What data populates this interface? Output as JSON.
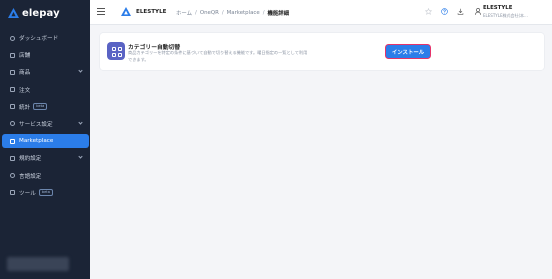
{
  "brand": {
    "name": "elepay",
    "accent": "#2b7de9",
    "sidebar_bg": "#1b2436",
    "highlight": "#e5336a"
  },
  "sidebar": {
    "items": [
      {
        "label": "ダッシュボード",
        "icon": "dashboard-icon",
        "chevron": false,
        "badge": "",
        "active": false
      },
      {
        "label": "店舗",
        "icon": "store-icon",
        "chevron": false,
        "badge": "",
        "active": false
      },
      {
        "label": "商品",
        "icon": "tag-icon",
        "chevron": true,
        "badge": "",
        "active": false
      },
      {
        "label": "注文",
        "icon": "cart-icon",
        "chevron": false,
        "badge": "",
        "active": false
      },
      {
        "label": "統計",
        "icon": "chart-icon",
        "chevron": false,
        "badge": "beta",
        "active": false
      },
      {
        "label": "サービス設定",
        "icon": "gear-icon",
        "chevron": true,
        "badge": "",
        "active": false
      },
      {
        "label": "Marketplace",
        "icon": "grid-icon",
        "chevron": false,
        "badge": "",
        "active": true
      },
      {
        "label": "規約設定",
        "icon": "document-icon",
        "chevron": true,
        "badge": "",
        "active": false
      },
      {
        "label": "言語設定",
        "icon": "globe-icon",
        "chevron": false,
        "badge": "",
        "active": false
      },
      {
        "label": "ツール",
        "icon": "wrench-icon",
        "chevron": false,
        "badge": "beta",
        "active": false
      }
    ]
  },
  "header": {
    "tenant_name": "ELESTYLE",
    "breadcrumb": [
      "ホーム",
      "OneQR",
      "Marketplace",
      "機能詳細"
    ],
    "icons": [
      "star-icon",
      "help-icon",
      "download-icon"
    ],
    "user_name": "ELESTYLE",
    "user_company": "ELESTYLE株式会社(本..."
  },
  "plugin": {
    "title": "カテゴリー自動切替",
    "description": "商品カテゴリーを特定の条件に基づいて自動で切り替える機能です。曜日指定の一覧として利用できます。",
    "install_label": "インストール"
  }
}
